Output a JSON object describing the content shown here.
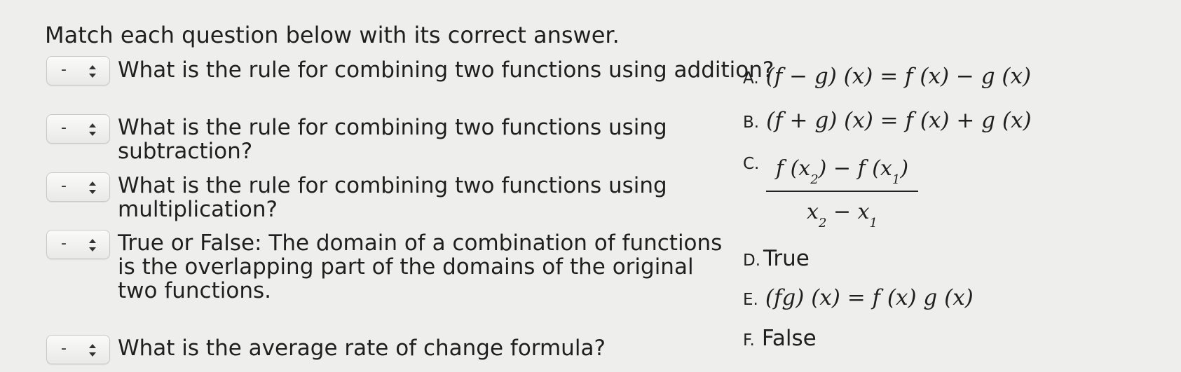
{
  "instructions": "Match each question below with its correct answer.",
  "questions": [
    {
      "select_value": "-",
      "text": "What is the rule for combining two functions using addition?"
    },
    {
      "select_value": "-",
      "text": "What is the rule for combining two functions using subtraction?"
    },
    {
      "select_value": "-",
      "text": "What is the rule for combining two functions using multiplication?"
    },
    {
      "select_value": "-",
      "text": "True or False: The domain of a combination of functions is the overlapping part of the domains of the original two functions."
    },
    {
      "select_value": "-",
      "text": "What is the average rate of change formula?"
    }
  ],
  "answers": [
    {
      "letter": "A.",
      "text": "(f − g) (x) = f (x) − g (x)"
    },
    {
      "letter": "B.",
      "text": "(f + g) (x) = f (x) + g (x)"
    },
    {
      "letter": "C.",
      "numerator_text": "f (x",
      "numerator_sub1": "2",
      "numerator_mid": ") − f (x",
      "numerator_sub2": "1",
      "numerator_end": ")",
      "denominator_a": "x",
      "denominator_sub1": "2",
      "denominator_mid": " − x",
      "denominator_sub2": "1"
    },
    {
      "letter": "D.",
      "text": "True"
    },
    {
      "letter": "E.",
      "text": "(fg) (x) = f (x) g (x)"
    },
    {
      "letter": "F.",
      "text": "False"
    }
  ],
  "icons": {
    "select_arrows": "up-down-chevron-icon"
  }
}
